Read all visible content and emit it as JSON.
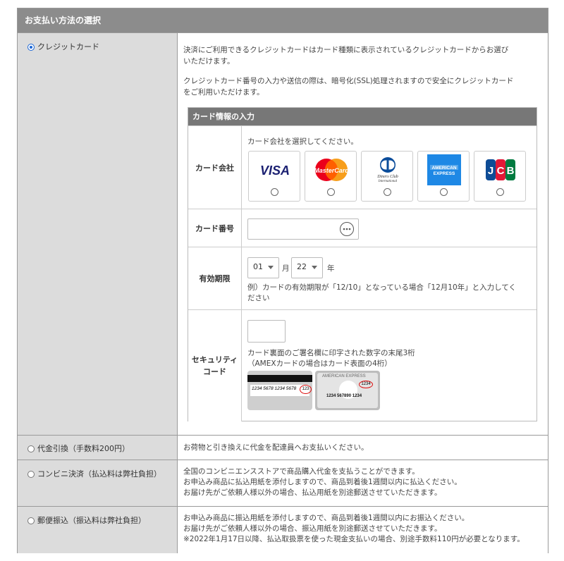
{
  "header": {
    "title": "お支払い方法の選択"
  },
  "options": [
    {
      "label": "クレジットカード",
      "selected": true
    },
    {
      "label": "代金引換（手数料200円）",
      "selected": false,
      "desc": [
        "お荷物と引き換えに代金を配達員へお支払いください。"
      ]
    },
    {
      "label": "コンビニ決済（払込料は弊社負担）",
      "selected": false,
      "desc": [
        "全国のコンビニエンスストアで商品購入代金を支払うことができます。",
        "お申込み商品に払込用紙を添付しますので、商品到着後1週間以内に払込ください。",
        "お届け先がご依頼人様以外の場合、払込用紙を別途郵送させていただきます。"
      ]
    },
    {
      "label": "郵便振込（振込料は弊社負担）",
      "selected": false,
      "desc": [
        "お申込み商品に振込用紙を添付しますので、商品到着後1週間以内にお振込ください。",
        "お届け先がご依頼人様以外の場合、振込用紙を別途郵送させていただきます。",
        "※2022年1月17日以降、払込取扱票を使った現金支払いの場合、別途手数料110円が必要となります。"
      ]
    }
  ],
  "credit": {
    "para1": [
      "決済にご利用できるクレジットカードはカード種類に表示されているクレジットカードからお選び",
      "いただけます。"
    ],
    "para2": [
      "クレジットカード番号の入力や送信の際は、暗号化(SSL)処理されますので安全にクレジットカード",
      "をご利用いただけます。"
    ],
    "form": {
      "title": "カード情報の入力",
      "company": {
        "label": "カード会社",
        "hint": "カード会社を選択してください。",
        "brands": [
          "VISA",
          "MasterCard",
          "Diners Club International",
          "AMERICAN EXPRESS",
          "JCB"
        ]
      },
      "number": {
        "label": "カード番号",
        "value": ""
      },
      "expiry": {
        "label": "有効期限",
        "month": "01",
        "month_unit": "月",
        "year": "22",
        "year_unit": "年",
        "note": [
          "例）カードの有効期限が「12/10」となっている場合「12月10年」と入力してく",
          "ださい"
        ]
      },
      "security": {
        "label_line1": "セキュリティ",
        "label_line2": "コード",
        "value": "",
        "note1": "カード裏面のご署名欄に印字された数字の末尾3桁",
        "note2": "（AMEXカードの場合はカード表面の4桁）",
        "card1_number": "1234 5678 1234 5678",
        "card1_code": "123",
        "card2_brand": "AMERICAN EXPRESS",
        "card2_code": "1234",
        "card2_number": "1234 567890 1234"
      }
    }
  },
  "colors": {
    "header_bg": "#8c8c8c",
    "left_bg": "#dcdcdc",
    "radio_selected": "#1a66d6"
  }
}
